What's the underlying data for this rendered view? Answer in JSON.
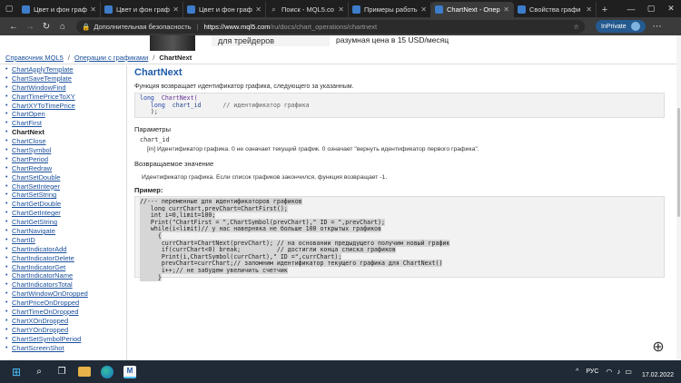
{
  "tabs": [
    {
      "label": "Цвет и фон граф",
      "icon": "mql5-icon",
      "active": false
    },
    {
      "label": "Цвет и фон граф",
      "icon": "mql5-icon",
      "active": false
    },
    {
      "label": "Цвет и фон граф",
      "icon": "mql5-icon",
      "active": false
    },
    {
      "label": "Поиск - MQL5.co",
      "icon": "search-icon",
      "active": false
    },
    {
      "label": "Примеры работы",
      "icon": "mql5-icon",
      "active": false
    },
    {
      "label": "ChartNext - Опера",
      "icon": "mql5-icon",
      "active": true
    },
    {
      "label": "Свойства графи",
      "icon": "mql5-icon",
      "active": false
    }
  ],
  "address": {
    "security": "Дополнительная безопасность",
    "url_host": "https://www.mql5.com",
    "url_path": "/ru/docs/chart_operations/chartnext"
  },
  "inprivate": "InPrivate",
  "banner": {
    "left_text": "для трейдеров",
    "right_text": "разумная цена в 15 USD/месяц"
  },
  "breadcrumb": {
    "item1": "Справочник MQL5",
    "item2": "Операции с графиками",
    "current": "ChartNext"
  },
  "sidebar": [
    "ChartApplyTemplate",
    "ChartSaveTemplate",
    "ChartWindowFind",
    "ChartTimePriceToXY",
    "ChartXYToTimePrice",
    "ChartOpen",
    "ChartFirst",
    "ChartNext",
    "ChartClose",
    "ChartSymbol",
    "ChartPeriod",
    "ChartRedraw",
    "ChartSetDouble",
    "ChartSetInteger",
    "ChartSetString",
    "ChartGetDouble",
    "ChartGetInteger",
    "ChartGetString",
    "ChartNavigate",
    "ChartID",
    "ChartIndicatorAdd",
    "ChartIndicatorDelete",
    "ChartIndicatorGet",
    "ChartIndicatorName",
    "ChartIndicatorsTotal",
    "ChartWindowOnDropped",
    "ChartPriceOnDropped",
    "ChartTimeOnDropped",
    "ChartXOnDropped",
    "ChartYOnDropped",
    "ChartSetSymbolPeriod",
    "ChartScreenShot"
  ],
  "sidebar_current": "ChartNext",
  "content": {
    "title": "ChartNext",
    "description": "Функция возвращает идентификатор графика, следующего за указанным.",
    "sig_line1_kw": "long",
    "sig_line1_fn": "ChartNext(",
    "sig_line2_kw": "long",
    "sig_line2_id": "chart_id",
    "sig_line2_cm": "// идентификатор графика",
    "sig_line3": ");",
    "params_title": "Параметры",
    "param_name": "chart_id",
    "param_desc": "[in]  Идентификатор графика. 0 не означает текущий график. 0 означает \"вернуть идентификатор первого графика\".",
    "return_title": "Возвращаемое значение",
    "return_desc": "Идентификатор графика. Если список графиков закончился, функция возвращает -1.",
    "example_title": "Пример:",
    "example_lines": [
      "//--- переменные для идентификаторов графиков",
      "   long currChart,prevChart=ChartFirst();",
      "   int i=0,limit=100;",
      "   Print(\"ChartFirst = \",ChartSymbol(prevChart),\" ID = \",prevChart);",
      "   while(i<limit)// у нас наверняка не больше 100 открытых графиков",
      "     {",
      "      currChart=ChartNext(prevChart); // на основании предыдущего получим новый график",
      "      if(currChart<0) break;          // достигли конца списка графиков",
      "      Print(i,ChartSymbol(currChart),\" ID =\",currChart);",
      "      prevChart=currChart;// запомним идентификатор текущего графика для ChartNext()",
      "      i++;// не забудем увеличить счетчик",
      "     }"
    ]
  },
  "taskbar": {
    "lang": "РУС",
    "date": "17.02.2022"
  }
}
